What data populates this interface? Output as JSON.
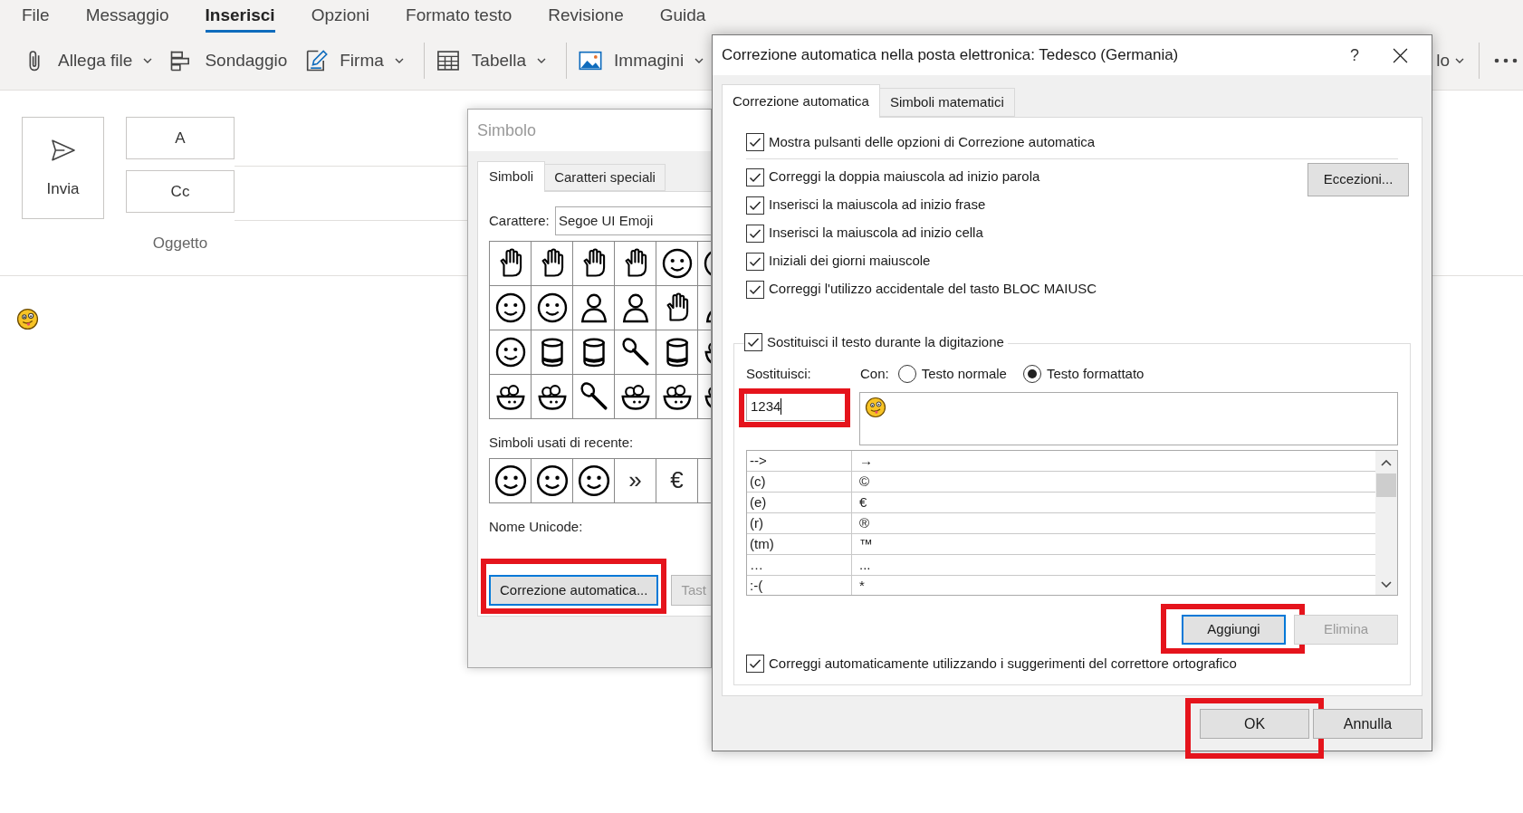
{
  "menu_tabs": [
    {
      "label": "File",
      "selected": false
    },
    {
      "label": "Messaggio",
      "selected": false
    },
    {
      "label": "Inserisci",
      "selected": true
    },
    {
      "label": "Opzioni",
      "selected": false
    },
    {
      "label": "Formato testo",
      "selected": false
    },
    {
      "label": "Revisione",
      "selected": false
    },
    {
      "label": "Guida",
      "selected": false
    }
  ],
  "toolbar": {
    "groups": [
      [
        {
          "label": "Allega file",
          "dropdown": true
        },
        {
          "label": "Sondaggio",
          "dropdown": false
        },
        {
          "label": "Firma",
          "dropdown": true
        }
      ],
      [
        {
          "label": "Tabella",
          "dropdown": true
        }
      ],
      [
        {
          "label": "Immagini",
          "dropdown": true
        }
      ]
    ],
    "partial_item": {
      "label": "lo",
      "dropdown": true
    }
  },
  "compose": {
    "send_button": "Invia",
    "to_button": "A",
    "cc_button": "Cc",
    "subject_label": "Oggetto"
  },
  "symbol_dialog": {
    "title": "Simbolo",
    "tabs": [
      {
        "label": "Simboli",
        "selected": true
      },
      {
        "label": "Caratteri speciali",
        "selected": false
      }
    ],
    "font_label": "Carattere:",
    "font_value": "Segoe UI Emoji",
    "recent_label": "Simboli usati di recente:",
    "recent_symbols": [
      "»",
      "€"
    ],
    "unicode_name_label": "Nome Unicode:",
    "buttons": [
      {
        "label": "Correzione automatica...",
        "highlighted": true,
        "disabled": false
      },
      {
        "label": "Tast",
        "highlighted": false,
        "disabled": true
      }
    ]
  },
  "autocorrect_dialog": {
    "title": "Correzione automatica nella posta elettronica: Tedesco (Germania)",
    "help": "?",
    "tabs": [
      {
        "label": "Correzione automatica",
        "selected": true
      },
      {
        "label": "Simboli matematici",
        "selected": false
      }
    ],
    "show_buttons": {
      "label": "Mostra pulsanti delle opzioni di Correzione automatica",
      "checked": true
    },
    "rules": [
      {
        "label": "Correggi la doppia maiuscola ad inizio parola",
        "checked": true
      },
      {
        "label": "Inserisci la maiuscola ad inizio frase",
        "checked": true
      },
      {
        "label": "Inserisci la maiuscola ad inizio cella",
        "checked": true
      },
      {
        "label": "Iniziali dei giorni maiuscole",
        "checked": true
      },
      {
        "label": "Correggi l'utilizzo accidentale del tasto BLOC MAIUSC",
        "checked": true
      }
    ],
    "exceptions_button": "Eccezioni...",
    "replace_group": {
      "label": "Sostituisci il testo durante la digitazione",
      "checked": true,
      "replace_label": "Sostituisci:",
      "with_label": "Con:",
      "formats": [
        {
          "label": "Testo normale",
          "selected": false
        },
        {
          "label": "Testo formattato",
          "selected": true
        }
      ],
      "replace_value": "1234",
      "replace_highlighted": true,
      "entries": [
        {
          "replace": "-->",
          "with": "→"
        },
        {
          "replace": "(c)",
          "with": "©"
        },
        {
          "replace": "(e)",
          "with": "€"
        },
        {
          "replace": "(r)",
          "with": "®"
        },
        {
          "replace": "(tm)",
          "with": "™"
        },
        {
          "replace": "…",
          "with": "..."
        },
        {
          "replace": ":-(",
          "with": "*"
        }
      ],
      "buttons": [
        {
          "label": "Aggiungi",
          "highlighted": true,
          "disabled": false
        },
        {
          "label": "Elimina",
          "highlighted": false,
          "disabled": true
        }
      ],
      "spellcheck": {
        "label": "Correggi automaticamente utilizzando i suggerimenti del correttore ortografico",
        "checked": true
      }
    },
    "buttons": [
      {
        "label": "OK",
        "highlighted": true
      },
      {
        "label": "Annulla",
        "highlighted": false
      }
    ]
  }
}
